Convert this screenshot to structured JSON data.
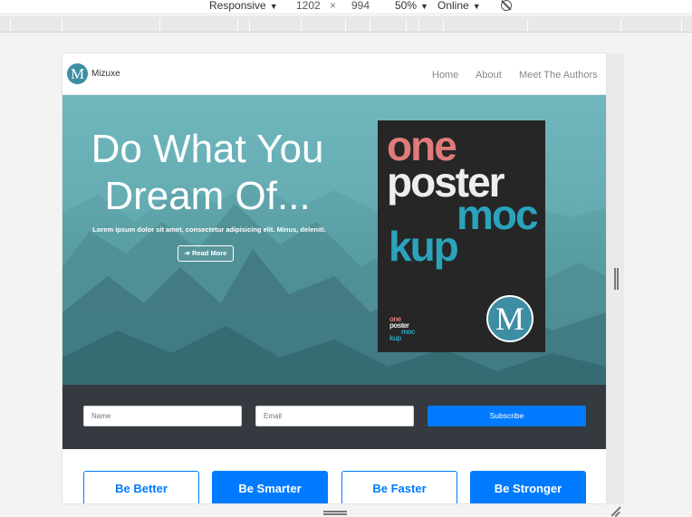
{
  "toolbar": {
    "device": "Responsive",
    "width": "1202",
    "times": "×",
    "height": "994",
    "zoom": "50%",
    "throttle": "Online",
    "caret": "▼"
  },
  "nav": {
    "brand_letter": "M",
    "brand_name": "Mizuxe",
    "links": [
      "Home",
      "About",
      "Meet The Authors"
    ]
  },
  "hero": {
    "title_line1": "Do What You",
    "title_line2": "Dream Of...",
    "text": "Lorem ipsum dolor sit amet, consectetur adipisicing elit. Minus, deleniti.",
    "button_icon": "➔",
    "button_label": "Read More"
  },
  "poster": {
    "word1": "one",
    "word2": "poster",
    "word3": "moc",
    "word4": "kup",
    "logo_letter": "M",
    "colors": {
      "one": "#e07b7b",
      "poster": "#ededed",
      "mockup": "#2aa3bd",
      "background": "#262626"
    }
  },
  "subscribe": {
    "name_placeholder": "Name",
    "email_placeholder": "Email",
    "button_label": "Subscribe"
  },
  "buttons": [
    "Be Better",
    "Be Smarter",
    "Be Faster",
    "Be Stronger"
  ],
  "colors": {
    "primary": "#007bff",
    "band": "#343a40",
    "hero": "#64acb2",
    "brand": "#3d8ea3"
  }
}
